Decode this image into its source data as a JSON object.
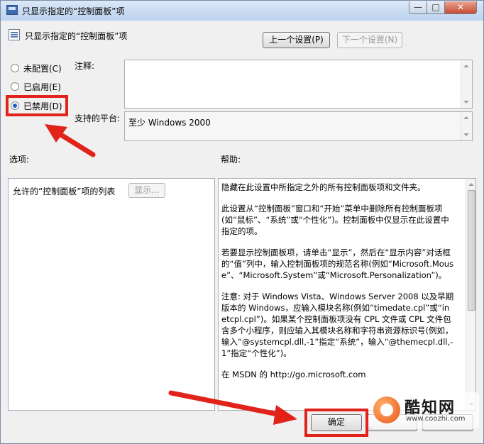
{
  "window": {
    "title": "只显示指定的“控制面板”项",
    "controls": {
      "minimize": "—",
      "maximize": "□",
      "close": "✕"
    }
  },
  "header": {
    "title": "只显示指定的“控制面板”项",
    "prev_button": "上一个设置(P)",
    "next_button": "下一个设置(N)"
  },
  "radios": [
    {
      "label": "未配置(C)",
      "selected": false
    },
    {
      "label": "已启用(E)",
      "selected": false
    },
    {
      "label": "已禁用(D)",
      "selected": true
    }
  ],
  "comment": {
    "label": "注释:",
    "value": ""
  },
  "platform": {
    "label": "支持的平台:",
    "value": "至少 Windows 2000"
  },
  "options": {
    "label": "选项:",
    "list_label": "允许的“控制面板”项的列表",
    "show_button": "显示..."
  },
  "help": {
    "label": "帮助:",
    "paragraphs": [
      "隐藏在此设置中所指定之外的所有控制面板项和文件夹。",
      "此设置从“控制面板”窗口和“开始”菜单中删除所有控制面板项(如“鼠标”、“系统”或“个性化”)。控制面板中仅显示在此设置中指定的项。",
      "若要显示控制面板项，请单击“显示”，然后在“显示内容”对话框的“值”列中，输入控制面板项的规范名称(例如“Microsoft.Mouse”、“Microsoft.System”或“Microsoft.Personalization”)。",
      "注意: 对于 Windows Vista、Windows Server 2008 以及早期版本的 Windows，应输入模块名称(例如“timedate.cpl”或“inetcpl.cpl”)。如果某个控制面板项没有 CPL 文件或 CPL 文件包含多个小程序，则应输入其模块名称和字符串资源标识号(例如，输入“@systemcpl.dll,-1”指定“系统”，输入“@themecpl.dll,-1”指定“个性化”)。",
      "在 MSDN 的 http://go.microsoft.com"
    ]
  },
  "footer": {
    "ok_button": "确定"
  },
  "watermark": {
    "title": "酷知网",
    "url": "www.coozhi.com"
  },
  "annotation_color": "#e2231a"
}
